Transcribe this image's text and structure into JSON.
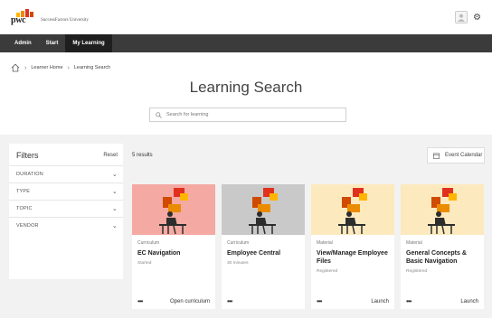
{
  "header": {
    "logo_text": "pwc",
    "logo_colors": [
      "#d04a02",
      "#e0301e",
      "#ffb600",
      "#eb8c00"
    ],
    "app_name": "SuccessFactors University",
    "avatar_icon": "user-avatar-icon",
    "settings_icon": "gear-icon"
  },
  "nav": {
    "items": [
      {
        "label": "Admin"
      },
      {
        "label": "Start"
      },
      {
        "label": "My Learning"
      }
    ],
    "active_index": 2,
    "background": "#3b3b3b"
  },
  "breadcrumb": {
    "items": [
      {
        "label": "Learner Home"
      },
      {
        "label": "Learning Search"
      }
    ]
  },
  "page": {
    "title": "Learning Search"
  },
  "search": {
    "placeholder": "Search for learning",
    "value": ""
  },
  "filters": {
    "title": "Filters",
    "reset_label": "Reset",
    "items": [
      {
        "label": "DURATION"
      },
      {
        "label": "TYPE"
      },
      {
        "label": "TOPIC"
      },
      {
        "label": "VENDOR"
      }
    ]
  },
  "results": {
    "count_label": "5 results",
    "event_calendar_label": "Event Calendar",
    "cards": [
      {
        "type": "Curriculum",
        "title": "EC Navigation",
        "subtitle": "Started",
        "action": "Open curriculum",
        "image_bg": "#f4a9a3"
      },
      {
        "type": "Curriculum",
        "title": "Employee Central",
        "subtitle": "30 minutes",
        "action": "",
        "image_bg": "#c9c9c9"
      },
      {
        "type": "Material",
        "title": "View/Manage Employee Files",
        "subtitle": "Registered",
        "action": "Launch",
        "image_bg": "#fde9be"
      },
      {
        "type": "Material",
        "title": "General Concepts & Basic Navigation",
        "subtitle": "Registered",
        "action": "Launch",
        "image_bg": "#fde9be"
      }
    ]
  }
}
